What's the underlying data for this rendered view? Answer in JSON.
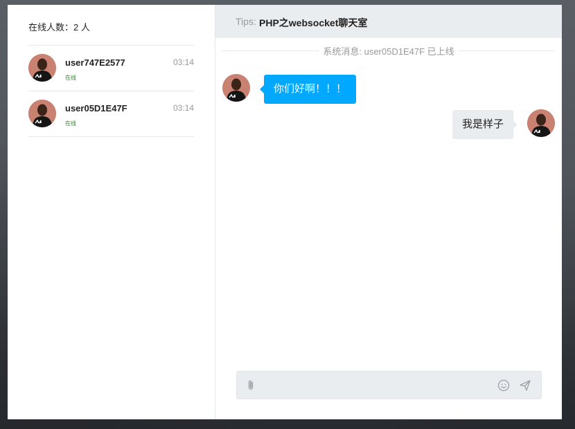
{
  "sidebar": {
    "online_label": "在线人数：2 人",
    "users": [
      {
        "name": "user747E2577",
        "status": "在线",
        "time": "03:14",
        "avatar": "user-avatar"
      },
      {
        "name": "user05D1E47F",
        "status": "在线",
        "time": "03:14",
        "avatar": "user-avatar"
      }
    ]
  },
  "chat": {
    "tips_label": "Tips:",
    "title": "PHP之websocket聊天室",
    "system_message": "系统消息: user05D1E47F 已上线",
    "messages": [
      {
        "side": "left",
        "text": "你们好啊！！！"
      },
      {
        "side": "right",
        "text": "我是样子"
      }
    ],
    "composer": {
      "value": "",
      "placeholder": "",
      "icons": [
        "paperclip-icon",
        "emoji-icon",
        "send-icon"
      ]
    }
  },
  "colors": {
    "accent": "#00a8ff",
    "header_bg": "#eaedf0",
    "status_online": "#2e8b2e"
  }
}
